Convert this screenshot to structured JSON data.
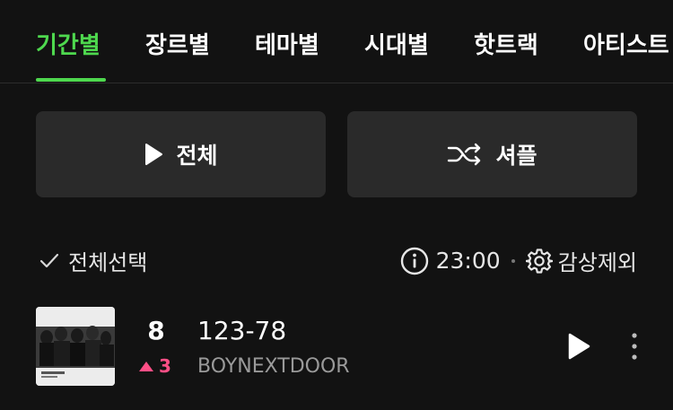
{
  "tabs": [
    {
      "label": "기간별",
      "active": true
    },
    {
      "label": "장르별",
      "active": false
    },
    {
      "label": "테마별",
      "active": false
    },
    {
      "label": "시대별",
      "active": false
    },
    {
      "label": "핫트랙",
      "active": false
    },
    {
      "label": "아티스트",
      "active": false
    }
  ],
  "actions": {
    "play_all_label": "전체",
    "shuffle_label": "셔플"
  },
  "controls": {
    "select_all_label": "전체선택",
    "timer_value": "23:00",
    "exclude_label": "감상제외"
  },
  "track": {
    "rank": "8",
    "rank_change": "3",
    "rank_direction": "up",
    "title": "123-78",
    "artist": "BOYNEXTDOOR"
  },
  "colors": {
    "background": "#121212",
    "accent": "#4ed84e",
    "rank_up": "#ff4f86",
    "button_bg": "#2a2a2a"
  }
}
